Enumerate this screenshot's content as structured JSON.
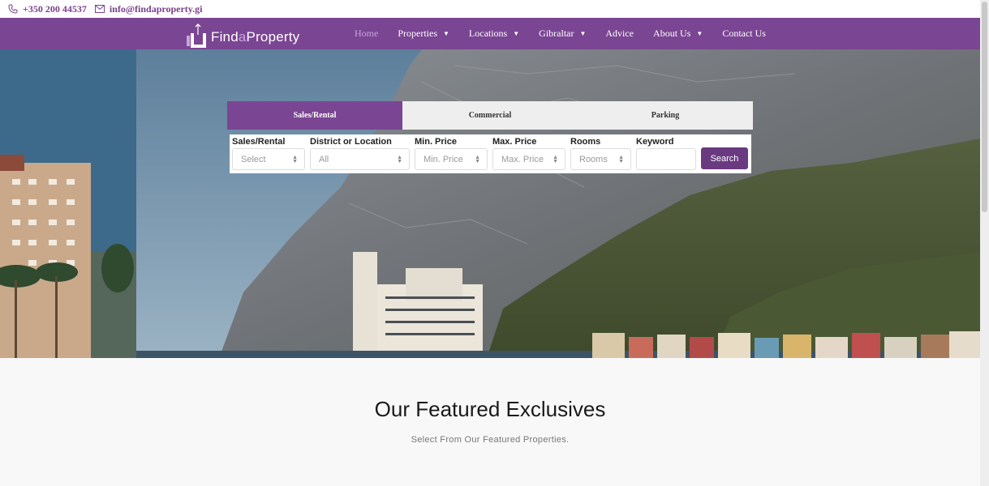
{
  "contact": {
    "phone": "+350 200 44537",
    "email": "info@findaproperty.gi",
    "phone_icon": "phone-icon",
    "email_icon": "envelope-icon"
  },
  "brand": {
    "logo_prefix": "Find",
    "logo_accent": "a",
    "logo_suffix": "Property",
    "primary_color": "#7a4592",
    "accent_color": "#c9a4e0"
  },
  "nav": {
    "items": [
      {
        "label": "Home",
        "active": true,
        "dropdown": false
      },
      {
        "label": "Properties",
        "dropdown": true
      },
      {
        "label": "Locations",
        "dropdown": true
      },
      {
        "label": "Gibraltar",
        "dropdown": true
      },
      {
        "label": "Advice",
        "dropdown": false
      },
      {
        "label": "About Us",
        "dropdown": true
      },
      {
        "label": "Contact Us",
        "dropdown": false
      }
    ],
    "caret": "▼"
  },
  "search": {
    "tabs": [
      "Sales/Rental",
      "Commercial",
      "Parking"
    ],
    "active_tab": "Sales/Rental",
    "fields": {
      "type": {
        "label": "Sales/Rental",
        "value": "Select"
      },
      "location": {
        "label": "District or Location",
        "value": "All"
      },
      "min_price": {
        "label": "Min. Price",
        "value": "Min. Price"
      },
      "max_price": {
        "label": "Max. Price",
        "value": "Max. Price"
      },
      "rooms": {
        "label": "Rooms",
        "value": "Rooms"
      },
      "keyword": {
        "label": "Keyword",
        "value": ""
      }
    },
    "button_label": "Search"
  },
  "featured": {
    "title": "Our Featured Exclusives",
    "subtitle": "Select From Our Featured Properties."
  }
}
